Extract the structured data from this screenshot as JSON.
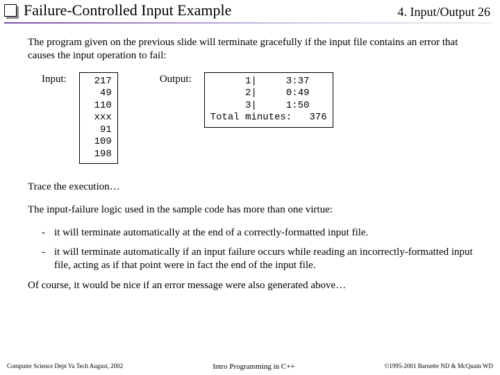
{
  "header": {
    "title": "Failure-Controlled Input Example",
    "section": "4. Input/Output  26"
  },
  "intro": "The program given on the previous slide will terminate gracefully if the input file contains an error that causes the input operation to fail:",
  "io": {
    "input_label": "Input:",
    "input_box": "217\n 49\n110\nxxx\n 91\n109\n198",
    "output_label": "Output:",
    "output_box": "      1|     3:37\n      2|     0:49\n      3|     1:50\nTotal minutes:   376"
  },
  "trace": "Trace the execution…",
  "virtue_intro": "The input-failure logic used in the sample code has more than one virtue:",
  "bullets": [
    "it will terminate automatically at the end of a correctly-formatted input file.",
    "it will terminate automatically if an input failure occurs while reading an incorrectly-formatted input file, acting as if that point were in fact the end of the input file."
  ],
  "closing": "Of course, it would be nice if an error message were also generated above…",
  "footer": {
    "left": "Computer Science Dept Va Tech  August, 2002",
    "center": "Intro Programming in C++",
    "right": "©1995-2001  Barnette ND & McQuain WD"
  }
}
